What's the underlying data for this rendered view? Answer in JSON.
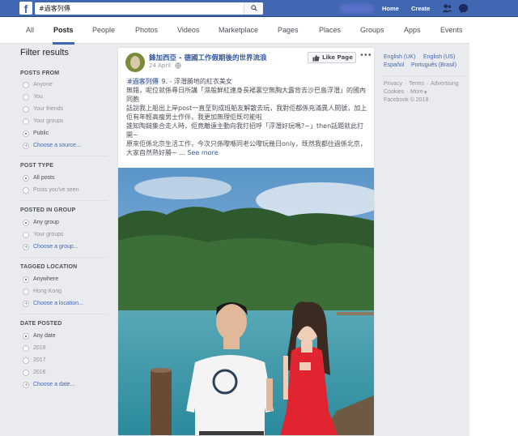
{
  "topbar": {
    "logo": "f",
    "search_value": "#過客列傳",
    "home": "Home",
    "create": "Create"
  },
  "tabs": [
    "All",
    "Posts",
    "People",
    "Photos",
    "Videos",
    "Marketplace",
    "Pages",
    "Places",
    "Groups",
    "Apps",
    "Events"
  ],
  "filters": {
    "title": "Filter results",
    "posts_from": {
      "heading": "POSTS FROM",
      "items": [
        "Anyone",
        "You",
        "Your friends",
        "Your groups",
        "Public"
      ],
      "selected": "Public",
      "link": "Choose a source..."
    },
    "post_type": {
      "heading": "POST TYPE",
      "items": [
        "All posts",
        "Posts you've seen"
      ],
      "selected": "All posts"
    },
    "posted_in_group": {
      "heading": "POSTED IN GROUP",
      "items": [
        "Any group",
        "Your groups"
      ],
      "selected": "Any group",
      "link": "Choose a group..."
    },
    "tagged_location": {
      "heading": "TAGGED LOCATION",
      "items": [
        "Anywhere",
        "Hong Kong"
      ],
      "selected": "Anywhere",
      "link": "Choose a location..."
    },
    "date_posted": {
      "heading": "DATE POSTED",
      "items": [
        "Any date",
        "2018",
        "2017",
        "2016"
      ],
      "selected": "Any date",
      "link": "Choose a date..."
    }
  },
  "post": {
    "author": "鋒加西亞 - 德國工作假期後的世界流浪",
    "date": "24 April",
    "like_page": "Like Page",
    "hashtag": "#過客列傳",
    "line1": "9. - 浮潛勝地的紅衣美女",
    "line2": "無錯，呢位就係尋日所講「濕般鮮紅連身長裙裏空無胸大露背去沙巴島浮潛」的國內同胞",
    "line3": "話說我上船出上岸post一直至到成班船友解散去玩，我對佢都係充滿異人問號，加上佢有年輕高瘦男士作伴，我更加無理佢既可能啦",
    "line4": "誰知陶鎚集合走人時，佢竟離遠主動向我打招呼「浮潛好玩嗎?~」then話題就此打開~",
    "line5": "原來佢係北京生活工作，今次只係嚟喺同老公嚟玩幾日only，既然我都住過係北京，大家自然熟好勝~ ...",
    "see_more": "See more"
  },
  "sidebar": {
    "lang1": "English (UK)",
    "lang2": "English (US)",
    "lang3": "Español",
    "lang4": "Português (Brasil)",
    "privacy": "Privacy",
    "terms": "Terms",
    "advertising": "Advertising",
    "cookies": "Cookies",
    "more": "More",
    "copyright": "Facebook © 2018"
  },
  "colors": {
    "brand": "#4267b2",
    "link": "#365899"
  }
}
